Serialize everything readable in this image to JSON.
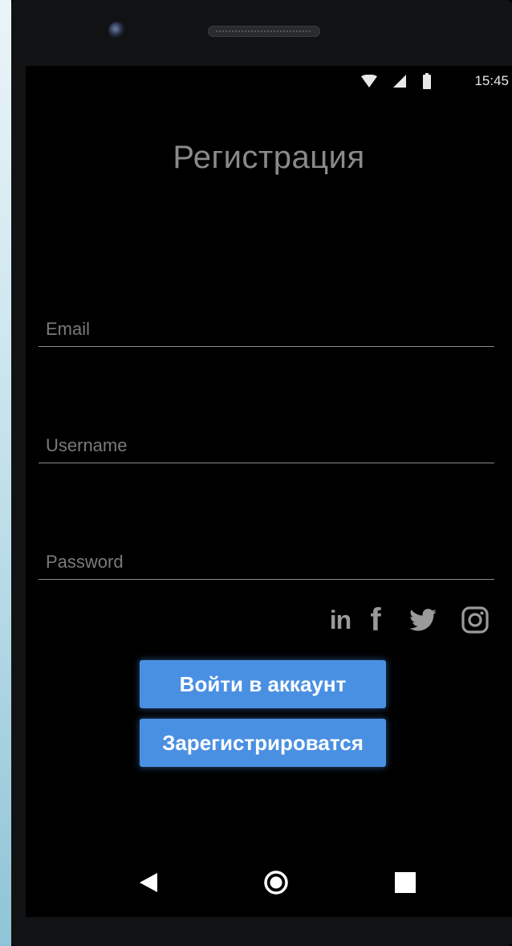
{
  "status_bar": {
    "time": "15:45",
    "icons": [
      "wifi-icon",
      "cell-signal-icon",
      "battery-icon"
    ]
  },
  "screen": {
    "title": "Регистрация"
  },
  "form": {
    "email": {
      "placeholder": "Email",
      "value": ""
    },
    "username": {
      "placeholder": "Username",
      "value": ""
    },
    "password": {
      "placeholder": "Password",
      "value": ""
    }
  },
  "social": {
    "items": [
      {
        "icon": "linkedin-icon",
        "text": "in"
      },
      {
        "icon": "facebook-icon",
        "text": "f"
      },
      {
        "icon": "twitter-icon"
      },
      {
        "icon": "instagram-icon"
      }
    ]
  },
  "buttons": {
    "login_label": "Войти в аккаунт",
    "register_label": "Зарегистрироватся"
  },
  "nav": {
    "items": [
      "back-icon",
      "home-icon",
      "recents-icon"
    ]
  },
  "colors": {
    "accent": "#4a90e2",
    "text_muted": "#8a8a8a",
    "background": "#000000"
  }
}
